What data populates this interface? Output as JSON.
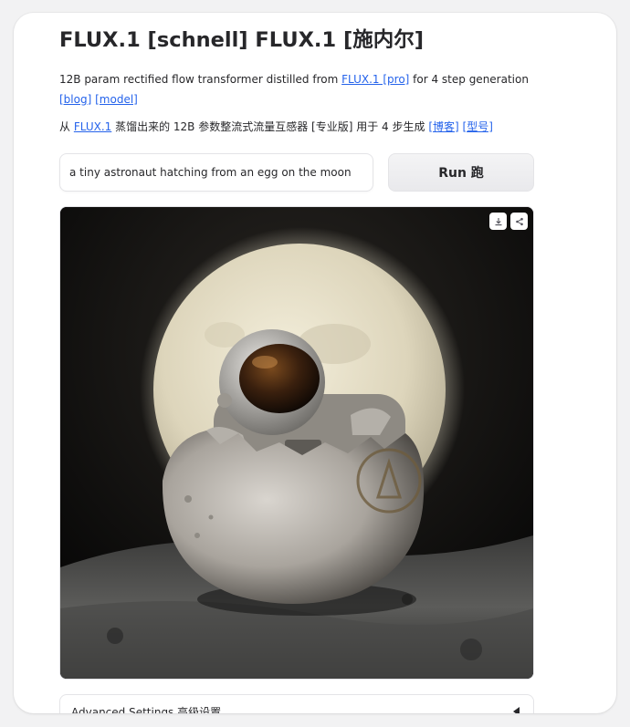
{
  "header": {
    "title": "FLUX.1 [schnell] FLUX.1 [施内尔]"
  },
  "description": {
    "line1_prefix": "12B param rectified flow transformer distilled from ",
    "line1_link1": "FLUX.1 [pro]",
    "line1_suffix": " for 4 step generation",
    "line1_link2": "[blog]",
    "line1_link3": "[model]",
    "line2_prefix": "从 ",
    "line2_link1": "FLUX.1",
    "line2_middle": " 蒸馏出来的 12B 参数整流式流量互感器 [专业版] 用于 4 步生成 ",
    "line2_link2": "[博客]",
    "line2_link3": "[型号]"
  },
  "prompt": {
    "value": "a tiny astronaut hatching from an egg on the moon"
  },
  "run_button": {
    "label": "Run 跑"
  },
  "output_image": {
    "alt": "a tiny astronaut hatching from an egg on the moon",
    "download_icon": "download-icon",
    "share_icon": "share-icon"
  },
  "advanced_settings": {
    "label": "Advanced Settings 高级设置",
    "caret_icon": "caret-left-icon"
  }
}
